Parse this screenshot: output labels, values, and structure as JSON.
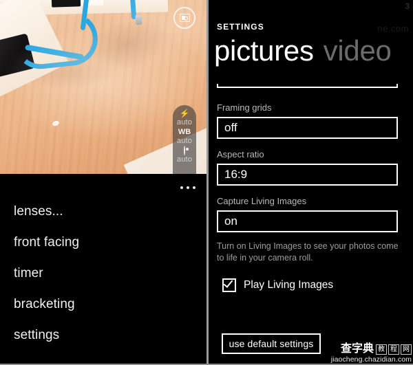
{
  "camera": {
    "mode_button_icon": "photo-mode-icon",
    "controls": [
      {
        "icon": "flash-icon",
        "glyph": "⚡",
        "value": "auto"
      },
      {
        "icon": "white-balance-icon",
        "glyph": "WB",
        "value": "auto"
      },
      {
        "icon": "iso-icon",
        "glyph": "",
        "value": "auto"
      }
    ],
    "appbar": {
      "more_icon": "ellipsis-icon",
      "items": [
        "lenses...",
        "front facing",
        "timer",
        "bracketing",
        "settings"
      ]
    }
  },
  "settings": {
    "header": "SETTINGS",
    "pivots": [
      {
        "label": "pictures",
        "selected": true
      },
      {
        "label": "video",
        "selected": false
      }
    ],
    "fields": [
      {
        "label": "Framing grids",
        "value": "off"
      },
      {
        "label": "Aspect ratio",
        "value": "16:9"
      },
      {
        "label": "Capture Living Images",
        "value": "on"
      }
    ],
    "hint": "Turn on Living Images to see your photos come to life in your camera roll.",
    "checkbox": {
      "label": "Play Living Images",
      "checked": true
    },
    "default_button": "use default settings"
  },
  "overlay": {
    "corner_number": "3",
    "ghost_text": "ne.com"
  },
  "watermark": {
    "brand": "查字典",
    "box1": "教",
    "box2": "程",
    "box3": "网",
    "url": "jiaocheng.chazidian.com"
  },
  "colors": {
    "background": "#000000",
    "foreground": "#ffffff",
    "muted": "#9d9d9d",
    "inactive_pivot": "#6b6b6b",
    "cable_blue": "#2da6e0",
    "divider": "#9a9a9a"
  }
}
